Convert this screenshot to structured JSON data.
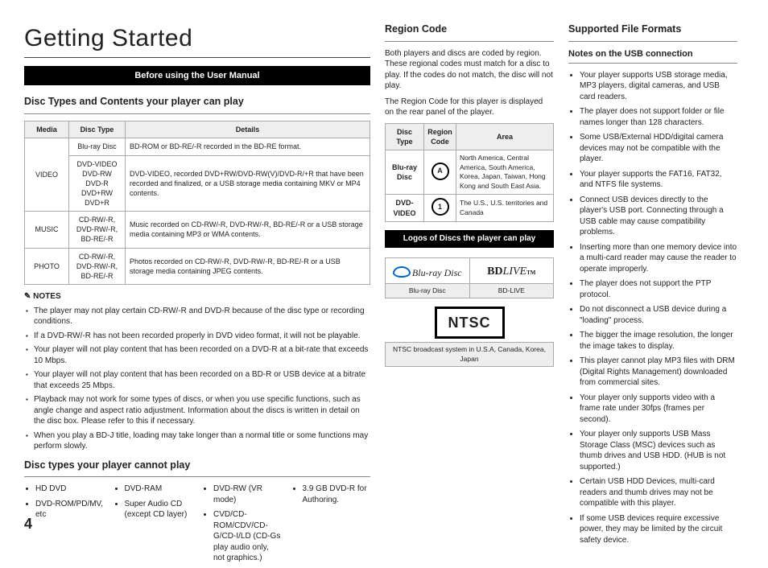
{
  "pageTitle": "Getting Started",
  "bar1": "Before using the User Manual",
  "h_discTypes": "Disc Types and Contents your player can play",
  "tbl1": {
    "h": [
      "Media",
      "Disc Type",
      "Details"
    ],
    "rows": [
      {
        "media": "VIDEO",
        "r1": {
          "type": "Blu-ray Disc",
          "det": "BD-ROM or BD-RE/-R recorded in the BD-RE format."
        },
        "r2": {
          "type": "DVD-VIDEO\nDVD-RW\nDVD-R\nDVD+RW\nDVD+R",
          "det": "DVD-VIDEO, recorded DVD+RW/DVD-RW(V)/DVD-R/+R that have been recorded and finalized, or a USB storage media containing MKV or MP4 contents."
        }
      },
      {
        "media": "MUSIC",
        "type": "CD-RW/-R,\nDVD-RW/-R,\nBD-RE/-R",
        "det": "Music recorded on CD-RW/-R, DVD-RW/-R, BD-RE/-R or a USB storage media containing MP3 or WMA contents."
      },
      {
        "media": "PHOTO",
        "type": "CD-RW/-R,\nDVD-RW/-R,\nBD-RE/-R",
        "det": "Photos recorded on CD-RW/-R, DVD-RW/-R, BD-RE/-R or a USB storage media containing JPEG contents."
      }
    ]
  },
  "notesLabel": "NOTES",
  "notes": [
    "The player may not play certain CD-RW/-R and DVD-R because of the disc type or recording conditions.",
    "If a DVD-RW/-R has not been recorded properly in DVD video format, it will not be playable.",
    "Your player will not play content that has been recorded on a DVD-R at a bit-rate that exceeds 10 Mbps.",
    "Your player will not play content that has been recorded on a BD-R or USB device at a bitrate that exceeds 25 Mbps.",
    "Playback may not work for some types of discs, or when you use specific functions, such as angle change and aspect ratio adjustment. Information about the discs is written in detail on the disc box. Please refer to this if necessary.",
    "When you play a BD-J title, loading may take longer than a normal title or some functions may perform slowly."
  ],
  "h_cannot": "Disc types your player cannot play",
  "cannot": {
    "c1": [
      "HD DVD",
      "DVD-ROM/PD/MV, etc"
    ],
    "c2": [
      "DVD-RAM",
      "Super Audio CD (except CD layer)"
    ],
    "c3": [
      "DVD-RW (VR mode)",
      "CVD/CD-ROM/CDV/CD-G/CD-I/LD (CD-Gs play audio only, not graphics.)"
    ],
    "c4": [
      "3.9 GB DVD-R for Authoring."
    ]
  },
  "h_region": "Region Code",
  "region_p1": "Both players and discs are coded by region. These regional codes must match for a disc to play. If the codes do not match, the disc will not play.",
  "region_p2": "The Region Code for this player is displayed on the rear panel of the player.",
  "region_tbl": {
    "h": [
      "Disc Type",
      "Region Code",
      "Area"
    ],
    "r1": {
      "type": "Blu-ray Disc",
      "area": "North America, Central America, South America, Korea, Japan, Taiwan, Hong Kong and South East Asia."
    },
    "r2": {
      "type": "DVD-VIDEO",
      "area": "The U.S., U.S. territories and Canada"
    }
  },
  "bar2": "Logos of Discs the player can play",
  "logos": {
    "l1": "Blu-ray Disc",
    "l2": "BD-LIVE",
    "ntsc": "NTSC",
    "ntsc_label": "NTSC broadcast system in U.S.A, Canada, Korea, Japan",
    "bluray_text": "Blu-ray Disc",
    "bdlive_text": "LIVE",
    "bdlive_prefix": "BD",
    "bdlive_tm": "TM"
  },
  "h_formats": "Supported File Formats",
  "h_usb": "Notes on the USB connection",
  "usb": [
    "Your player supports USB storage media, MP3 players, digital cameras, and USB card readers.",
    "The player does not support folder or file names longer than 128 characters.",
    "Some USB/External HDD/digital camera devices may not be compatible with the player.",
    "Your player supports the FAT16, FAT32, and NTFS file systems.",
    "Connect USB devices directly to the player's USB port. Connecting through a USB cable may cause compatibility problems.",
    "Inserting more than one memory device into a multi-card reader may cause the reader to operate improperly.",
    "The player does not support the PTP protocol.",
    "Do not disconnect a USB device during a \"loading\" process.",
    "The bigger the image resolution, the longer the image takes to display.",
    "This player cannot play MP3 files with DRM (Digital Rights Management) downloaded from commercial sites.",
    "Your player only supports video with a frame rate under 30fps (frames per second).",
    "Your player only supports USB Mass Storage Class (MSC) devices such as thumb drives and USB HDD. (HUB is not supported.)",
    "Certain USB HDD Devices, multi-card readers and thumb drives may not be compatible with this player.",
    "If some USB devices require excessive power, they may be limited by the circuit safety device."
  ],
  "pagenum": "4"
}
